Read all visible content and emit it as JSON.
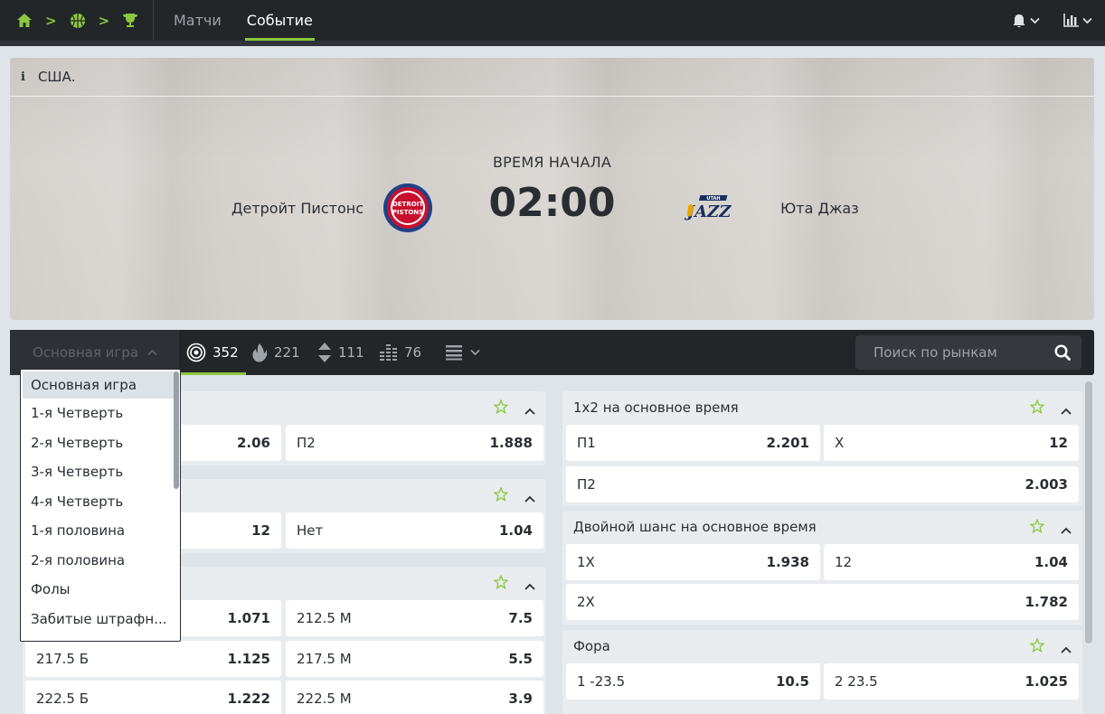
{
  "nav": {
    "breadcrumb_icons": [
      "home-icon",
      "basketball-icon",
      "trophy-icon"
    ],
    "tabs": [
      {
        "label": "Матчи"
      },
      {
        "label": "Событие"
      }
    ],
    "active_tab": "Событие"
  },
  "event": {
    "country": "США.",
    "start_label": "ВРЕМЯ НАЧАЛА",
    "start_time": "02:00",
    "home_team": "Детройт Пистонс",
    "away_team": "Юта Джаз",
    "home_logo_text": "DETROIT PISTONS",
    "away_logo_text": "JAZZ"
  },
  "markets_bar": {
    "selected_group": "Основная игра",
    "filters": [
      {
        "icon": "target-icon",
        "count": "352",
        "active": true
      },
      {
        "icon": "fire-icon",
        "count": "221"
      },
      {
        "icon": "up-down-arrows-icon",
        "count": "111"
      },
      {
        "icon": "bar-levels-icon",
        "count": "76"
      }
    ],
    "search_placeholder": "Поиск по рынкам"
  },
  "dropdown": {
    "items": [
      {
        "label": "Основная игра"
      },
      {
        "label": "1-я Четверть"
      },
      {
        "label": "2-я Четверть"
      },
      {
        "label": "3-я Четверть"
      },
      {
        "label": "4-я Четверть"
      },
      {
        "label": "1-я половина"
      },
      {
        "label": "2-я половина"
      },
      {
        "label": "Фолы"
      },
      {
        "label": "Забитые штрафн..."
      }
    ]
  },
  "left_markets": [
    {
      "odds": [
        {
          "label": "",
          "value": "2.06"
        },
        {
          "label": "П2",
          "value": "1.888"
        }
      ]
    },
    {
      "odds": [
        {
          "label": "",
          "value": "12"
        },
        {
          "label": "Нет",
          "value": "1.04"
        }
      ]
    },
    {
      "odds": [
        {
          "label": "",
          "value": "1.071"
        },
        {
          "label": "212.5 М",
          "value": "7.5"
        },
        {
          "label": "217.5 Б",
          "value": "1.125"
        },
        {
          "label": "217.5 М",
          "value": "5.5"
        },
        {
          "label": "222.5 Б",
          "value": "1.222"
        },
        {
          "label": "222.5 М",
          "value": "3.9"
        }
      ]
    }
  ],
  "right_markets": [
    {
      "title": "1х2 на основное время",
      "odds": [
        {
          "label": "П1",
          "value": "2.201"
        },
        {
          "label": "X",
          "value": "12"
        },
        {
          "label": "П2",
          "value": "2.003"
        }
      ]
    },
    {
      "title": "Двойной шанс на основное время",
      "odds": [
        {
          "label": "1X",
          "value": "1.938"
        },
        {
          "label": "12",
          "value": "1.04"
        },
        {
          "label": "2X",
          "value": "1.782"
        }
      ]
    },
    {
      "title": "Фора",
      "odds": [
        {
          "label": "1 -23.5",
          "value": "10.5"
        },
        {
          "label": "2 23.5",
          "value": "1.025"
        }
      ]
    }
  ],
  "colors": {
    "accent": "#8dc63f",
    "dark": "#232629",
    "panel": "#e9ecef"
  }
}
